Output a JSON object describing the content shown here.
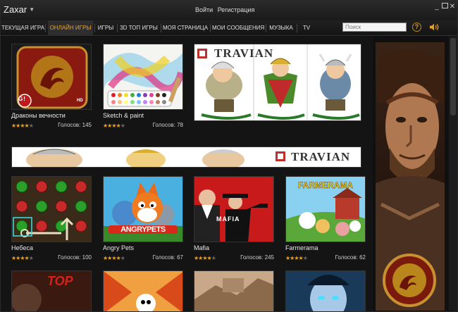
{
  "app": {
    "name": "Zaxar"
  },
  "auth": {
    "login": "Войти",
    "register": "Регистрация"
  },
  "nav": {
    "tabs": [
      {
        "label": "ТЕКУЩАЯ ИГРА"
      },
      {
        "label": "ОНЛАЙН ИГРЫ",
        "active": true
      },
      {
        "label": "ИГРЫ"
      },
      {
        "label": "3D ТОП ИГРЫ"
      },
      {
        "label": "МОЯ СТРАНИЦА"
      },
      {
        "label": "МОИ СООБЩЕНИЯ"
      },
      {
        "label": "МУЗЫКА"
      },
      {
        "label": "TV"
      }
    ],
    "search_placeholder": "Поиск",
    "help_label": "?"
  },
  "banners": {
    "travian_text": "TRAVIAN"
  },
  "games": [
    {
      "name": "Драконы вечности",
      "stars": 4,
      "votes_label": "Голосов:",
      "votes": "145"
    },
    {
      "name": "Sketch & paint",
      "stars": 4,
      "votes_label": "Голосов:",
      "votes": "78"
    },
    {
      "name": "Небеса",
      "stars": 4,
      "votes_label": "Голосов:",
      "votes": "100"
    },
    {
      "name": "Angry Pets",
      "stars": 4,
      "votes_label": "Голосов:",
      "votes": "67"
    },
    {
      "name": "Mafia",
      "stars": 4,
      "votes_label": "Голосов:",
      "votes": "245"
    },
    {
      "name": "Farmerama",
      "stars": 4,
      "votes_label": "Голосов:",
      "votes": "62"
    }
  ],
  "thumb_text": {
    "g1": "G!",
    "hd": "HD",
    "angry": "ANGRYPETS",
    "mafia": "MAFIA",
    "farmerama": "FARMERAMA",
    "top": "TOP"
  },
  "colors": {
    "accent": "#f0a020",
    "background": "#101010"
  }
}
